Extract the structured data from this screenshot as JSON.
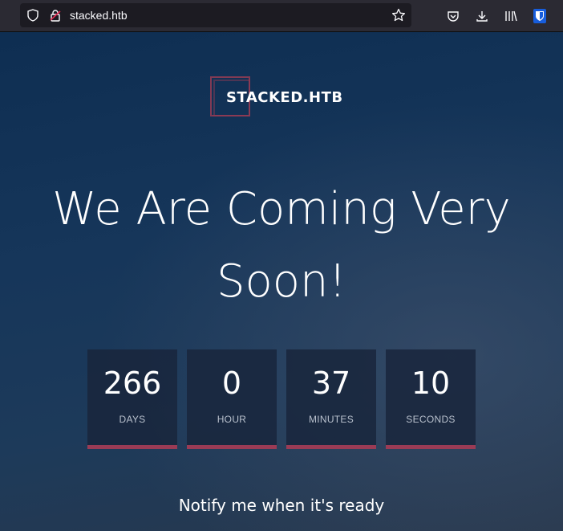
{
  "browser": {
    "url": "stacked.htb"
  },
  "site": {
    "logo_text": "STACKED.HTB",
    "headline_line1": "We Are Coming Very",
    "headline_line2": "Soon!",
    "notify_text": "Notify me when it's ready",
    "accent_color": "#9a3b55"
  },
  "countdown": [
    {
      "value": "266",
      "label": "DAYS"
    },
    {
      "value": "0",
      "label": "HOUR"
    },
    {
      "value": "37",
      "label": "MINUTES"
    },
    {
      "value": "10",
      "label": "SECONDS"
    }
  ]
}
